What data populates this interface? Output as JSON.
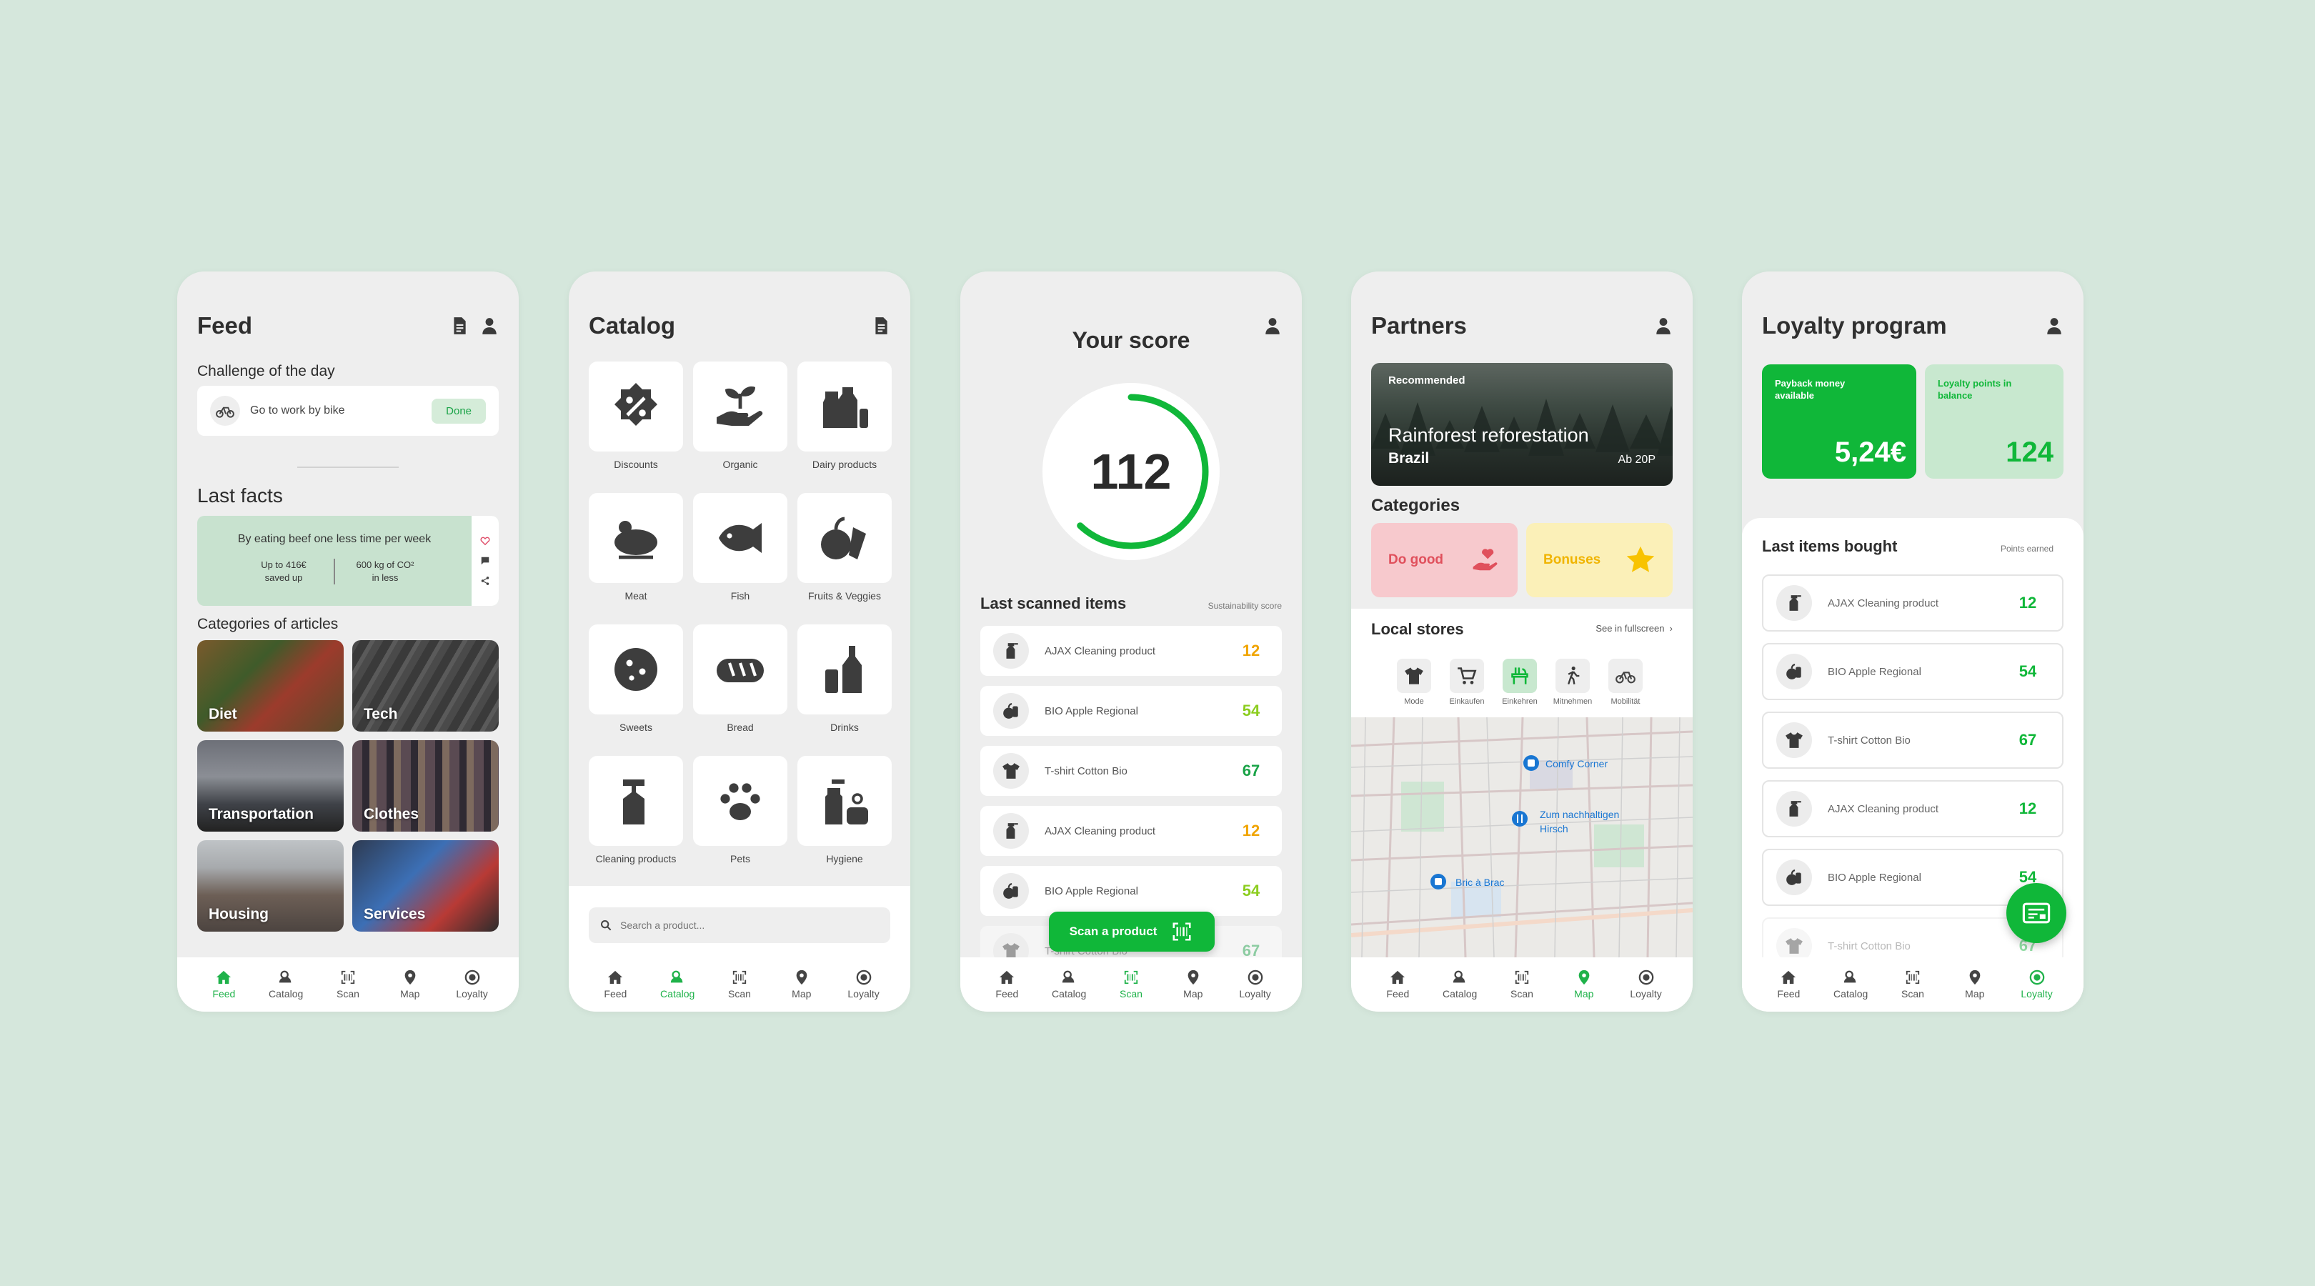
{
  "nav": [
    "Feed",
    "Catalog",
    "Scan",
    "Map",
    "Loyalty"
  ],
  "feed": {
    "title": "Feed",
    "challenge_heading": "Challenge of the day",
    "challenge_text": "Go to work by bike",
    "done_label": "Done",
    "last_facts_heading": "Last facts",
    "fact_text": "By eating beef one less time per week",
    "fact_stat1_line1": "Up to 416€",
    "fact_stat1_line2": "saved up",
    "fact_stat2_line1": "600 kg of CO²",
    "fact_stat2_line2": "in less",
    "categories_heading": "Categories of articles",
    "tiles": [
      "Diet",
      "Tech",
      "Transportation",
      "Clothes",
      "Housing",
      "Services"
    ]
  },
  "catalog": {
    "title": "Catalog",
    "items": [
      "Discounts",
      "Organic",
      "Dairy products",
      "Meat",
      "Fish",
      "Fruits & Veggies",
      "Sweets",
      "Bread",
      "Drinks",
      "Cleaning products",
      "Pets",
      "Hygiene"
    ],
    "search_placeholder": "Search a product..."
  },
  "score": {
    "title": "Your score",
    "value": "112",
    "progress_fraction": 0.62,
    "list_heading": "Last scanned items",
    "list_sub": "Sustainability score",
    "items": [
      {
        "name": "AJAX Cleaning product",
        "value": "12",
        "color": "#f0a400"
      },
      {
        "name": "BIO Apple Regional",
        "value": "54",
        "color": "#8ccd1f"
      },
      {
        "name": "T-shirt Cotton Bio",
        "value": "67",
        "color": "#1aa347"
      },
      {
        "name": "AJAX Cleaning product",
        "value": "12",
        "color": "#f0a400"
      },
      {
        "name": "BIO Apple Regional",
        "value": "54",
        "color": "#8ccd1f"
      },
      {
        "name": "T-shirt Cotton Bio",
        "value": "67",
        "color": "#1aa347"
      }
    ],
    "scan_label": "Scan a product"
  },
  "partners": {
    "title": "Partners",
    "banner_tag": "Recommended",
    "banner_title": "Rainforest reforestation",
    "banner_sub": "Brazil",
    "banner_price": "Ab 20P",
    "categories_heading": "Categories",
    "cat_do_good": "Do good",
    "cat_bonuses": "Bonuses",
    "stores_heading": "Local stores",
    "see_fullscreen": "See in fullscreen",
    "chips": [
      "Mode",
      "Einkaufen",
      "Einkehren",
      "Mitnehmen",
      "Mobilität"
    ],
    "map_pins": [
      "Comfy Corner",
      "Zum nachhaltigen",
      "Hirsch",
      "Bric à Brac"
    ]
  },
  "loyalty": {
    "title": "Loyalty program",
    "payback_label": "Payback money available",
    "payback_value": "5,24€",
    "points_label": "Loyalty points in balance",
    "points_value": "124",
    "list_heading": "Last items bought",
    "list_sub": "Points earned",
    "items": [
      {
        "name": "AJAX Cleaning product",
        "value": "12"
      },
      {
        "name": "BIO Apple Regional",
        "value": "54"
      },
      {
        "name": "T-shirt Cotton Bio",
        "value": "67"
      },
      {
        "name": "AJAX Cleaning product",
        "value": "12"
      },
      {
        "name": "BIO Apple Regional",
        "value": "54"
      },
      {
        "name": "T-shirt Cotton Bio",
        "value": "67"
      }
    ]
  },
  "colors": {
    "accent": "#10b739",
    "background": "#d5e7dc",
    "card": "#eeeeee"
  }
}
